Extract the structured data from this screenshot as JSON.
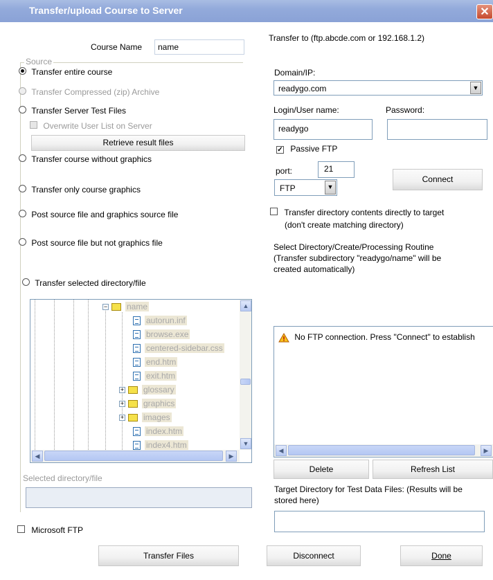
{
  "window": {
    "title": "Transfer/upload Course to Server",
    "close_glyph": "✕"
  },
  "course": {
    "label": "Course Name",
    "value": "name"
  },
  "source": {
    "legend": "Source",
    "options": [
      {
        "label": "Transfer entire course",
        "selected": true,
        "enabled": true
      },
      {
        "label": "Transfer Compressed (zip) Archive",
        "selected": false,
        "enabled": false
      },
      {
        "label": "Transfer Server Test Files",
        "selected": false,
        "enabled": true
      },
      {
        "label": "Transfer course without graphics",
        "selected": false,
        "enabled": true
      },
      {
        "label": "Transfer only course graphics",
        "selected": false,
        "enabled": true
      },
      {
        "label": "Post source file and graphics source file",
        "selected": false,
        "enabled": true
      },
      {
        "label": "Post source file but not graphics file",
        "selected": false,
        "enabled": true
      },
      {
        "label": "Transfer selected directory/file",
        "selected": false,
        "enabled": true
      }
    ],
    "overwrite_label": "Overwrite User List on Server",
    "retrieve_button": "Retrieve result files"
  },
  "tree": {
    "items": [
      {
        "name": "name",
        "icon": "folder-icon",
        "expander": "−"
      },
      {
        "name": "autorun.inf",
        "icon": "file-icon"
      },
      {
        "name": "browse.exe",
        "icon": "file-icon"
      },
      {
        "name": "centered-sidebar.css",
        "icon": "file-icon"
      },
      {
        "name": "end.htm",
        "icon": "file-icon"
      },
      {
        "name": "exit.htm",
        "icon": "file-icon"
      },
      {
        "name": "glossary",
        "icon": "folder-icon",
        "expander": "+"
      },
      {
        "name": "graphics",
        "icon": "folder-icon",
        "expander": "+"
      },
      {
        "name": "images",
        "icon": "folder-icon",
        "expander": "+"
      },
      {
        "name": "index.htm",
        "icon": "file-icon"
      },
      {
        "name": "index4.htm",
        "icon": "file-icon"
      }
    ]
  },
  "selected": {
    "label": "Selected directory/file",
    "value": ""
  },
  "microsoft_ftp": {
    "label": "Microsoft FTP",
    "checked": false
  },
  "transfer": {
    "heading": "Transfer to (ftp.abcde.com or 192.168.1.2)",
    "domain_label": "Domain/IP:",
    "domain_value": "readygo.com",
    "login_label": "Login/User name:",
    "login_value": "readygo",
    "password_label": "Password:",
    "password_value": "",
    "passive_label": "Passive FTP",
    "passive_checked": true,
    "port_label": "port:",
    "port_value": "21",
    "protocol_value": "FTP",
    "connect_button": "Connect",
    "direct_line1": "Transfer directory contents directly to target",
    "direct_line2": "(don't create matching directory)",
    "select_dir_line1": "Select Directory/Create/Processing Routine",
    "select_dir_line2": "(Transfer subdirectory \"readygo/name\" will be",
    "select_dir_line3": "created automatically)"
  },
  "messages": {
    "items": [
      "No FTP connection.  Press \"Connect\" to establish"
    ]
  },
  "list_buttons": {
    "delete": "Delete",
    "refresh": "Refresh List"
  },
  "target": {
    "label_line1": "Target Directory for Test Data Files: (Results will be",
    "label_line2": "stored here)",
    "value": ""
  },
  "footer": {
    "transfer_files": "Transfer Files",
    "disconnect": "Disconnect",
    "done": "Done"
  },
  "colors": {
    "titlebar": "#93aadb",
    "field_border": "#7f9db9",
    "disabled_text": "#9a9a9a",
    "selection_bg": "#ece7d5"
  }
}
